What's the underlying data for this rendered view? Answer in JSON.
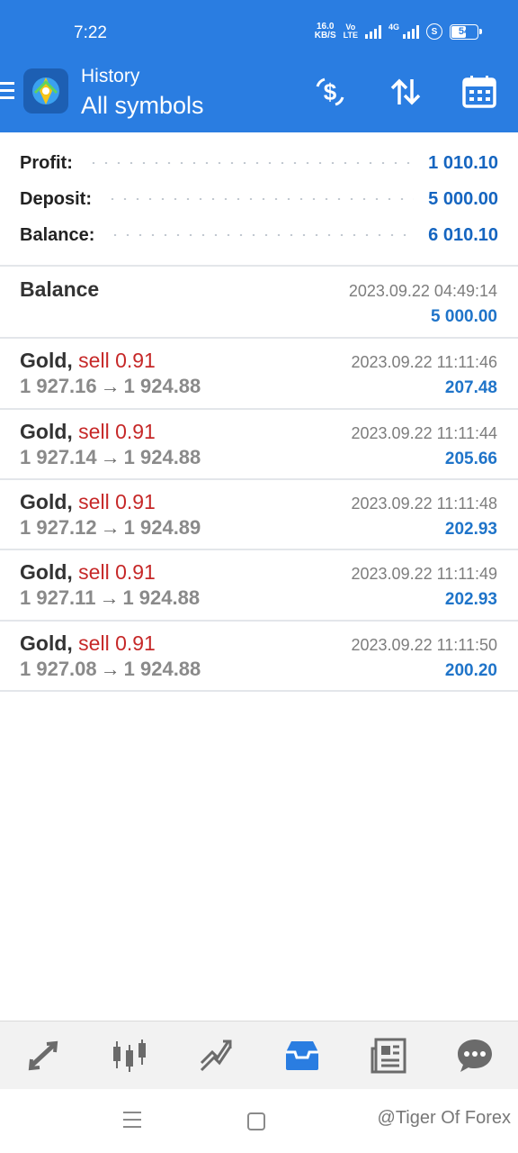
{
  "status_bar": {
    "time": "7:22",
    "net_speed_value": "16.0",
    "net_speed_unit": "KB/S",
    "volte_top": "Vo",
    "volte_bottom": "LTE",
    "network": "4G",
    "vpn_icon": "S",
    "battery": "54"
  },
  "app_bar": {
    "title": "History",
    "subtitle": "All symbols",
    "icons": [
      "menu-icon",
      "app-logo",
      "deposit-dollar-icon",
      "sort-icon",
      "calendar-icon"
    ]
  },
  "summary": {
    "profit_label": "Profit:",
    "profit_value": "1 010.10",
    "deposit_label": "Deposit:",
    "deposit_value": "5 000.00",
    "balance_label": "Balance:",
    "balance_value": "6 010.10"
  },
  "history": {
    "balance_entry": {
      "title": "Balance",
      "time": "2023.09.22 04:49:14",
      "value": "5 000.00"
    },
    "trades": [
      {
        "symbol": "Gold,",
        "direction": "sell 0.91",
        "open": "1 927.16",
        "close": "1 924.88",
        "time": "2023.09.22 11:11:46",
        "profit": "207.48"
      },
      {
        "symbol": "Gold,",
        "direction": "sell 0.91",
        "open": "1 927.14",
        "close": "1 924.88",
        "time": "2023.09.22 11:11:44",
        "profit": "205.66"
      },
      {
        "symbol": "Gold,",
        "direction": "sell 0.91",
        "open": "1 927.12",
        "close": "1 924.89",
        "time": "2023.09.22 11:11:48",
        "profit": "202.93"
      },
      {
        "symbol": "Gold,",
        "direction": "sell 0.91",
        "open": "1 927.11",
        "close": "1 924.88",
        "time": "2023.09.22 11:11:49",
        "profit": "202.93"
      },
      {
        "symbol": "Gold,",
        "direction": "sell 0.91",
        "open": "1 927.08",
        "close": "1 924.88",
        "time": "2023.09.22 11:11:50",
        "profit": "200.20"
      }
    ],
    "arrow": "→"
  },
  "bottom_nav": {
    "items": [
      "quotes-icon",
      "chart-icon",
      "trade-icon",
      "history-icon",
      "news-icon",
      "chat-icon"
    ],
    "active": "history-icon"
  },
  "watermark": "@Tiger Of Forex",
  "colors": {
    "primary_blue": "#2a7de1",
    "value_blue": "#1f74c9",
    "sell_red": "#c62828",
    "muted_gray": "#8a8a8a"
  }
}
